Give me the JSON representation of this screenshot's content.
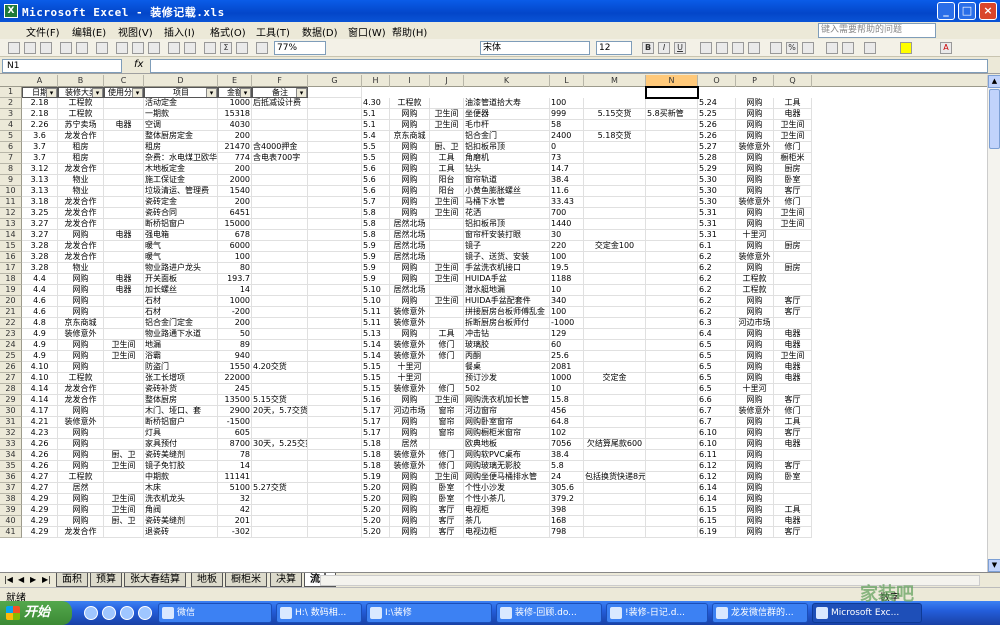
{
  "window": {
    "title": "Microsoft Excel - 装修记载.xls",
    "buttons": [
      "_",
      "□",
      "×"
    ]
  },
  "menu": [
    "文件(F)",
    "编辑(E)",
    "视图(V)",
    "插入(I)",
    "格式(O)",
    "工具(T)",
    "数据(D)",
    "窗口(W)",
    "帮助(H)"
  ],
  "help_placeholder": "键入需要帮助的问题",
  "toolbar": {
    "zoom": "77%",
    "font": "宋体",
    "size": "12",
    "bold": "B",
    "italic": "I",
    "underline": "U"
  },
  "formula_bar": {
    "name_box": "N1",
    "fx": "fx",
    "value": ""
  },
  "col_letters": [
    "A",
    "B",
    "C",
    "D",
    "E",
    "F",
    "G",
    "H",
    "I",
    "J",
    "K",
    "L",
    "M",
    "N",
    "O",
    "P",
    "Q"
  ],
  "headers": [
    "日期",
    "装修大类",
    "使用分类",
    "项目",
    "金额",
    "备注"
  ],
  "left_rows": [
    [
      "2.18",
      "工程款",
      "",
      "活动定金",
      "1000",
      "后抵减设计费"
    ],
    [
      "2.18",
      "工程款",
      "",
      "一期款",
      "15318",
      ""
    ],
    [
      "2.26",
      "苏宁卖场",
      "电器",
      "空调",
      "4030",
      ""
    ],
    [
      "3.6",
      "龙发合作",
      "",
      "整体厨房定金",
      "200",
      ""
    ],
    [
      "3.7",
      "租房",
      "",
      "租房",
      "21470",
      "含4000押金"
    ],
    [
      "3.7",
      "租房",
      "",
      "杂费：水电煤卫欧华",
      "774",
      "含电表700字"
    ],
    [
      "3.12",
      "龙发合作",
      "",
      "木地板定金",
      "200",
      ""
    ],
    [
      "3.13",
      "物业",
      "",
      "施工保证金",
      "2000",
      ""
    ],
    [
      "3.13",
      "物业",
      "",
      "垃圾清运、管理费",
      "1540",
      ""
    ],
    [
      "3.18",
      "龙发合作",
      "",
      "瓷砖定金",
      "200",
      ""
    ],
    [
      "3.25",
      "龙发合作",
      "",
      "瓷砖合同",
      "6451",
      ""
    ],
    [
      "3.27",
      "龙发合作",
      "",
      "断桥铝窗户",
      "15000",
      ""
    ],
    [
      "3.27",
      "网购",
      "电器",
      "强电箱",
      "678",
      ""
    ],
    [
      "3.28",
      "龙发合作",
      "",
      "暖气",
      "6000",
      ""
    ],
    [
      "3.28",
      "龙发合作",
      "",
      "暖气",
      "100",
      ""
    ],
    [
      "3.28",
      "物业",
      "",
      "物业路进户龙头",
      "80",
      ""
    ],
    [
      "4.4",
      "网购",
      "电器",
      "开关面板",
      "193.7",
      ""
    ],
    [
      "4.4",
      "网购",
      "电器",
      "加长螺丝",
      "14",
      ""
    ],
    [
      "4.6",
      "网购",
      "",
      "石材",
      "1000",
      ""
    ],
    [
      "4.6",
      "网购",
      "",
      "石材",
      "-200",
      ""
    ],
    [
      "4.8",
      "京东商城",
      "",
      "铝合金门定金",
      "200",
      ""
    ],
    [
      "4.9",
      "装修意外",
      "",
      "物业路通下水道",
      "50",
      ""
    ],
    [
      "4.9",
      "网购",
      "卫生间",
      "地漏",
      "89",
      ""
    ],
    [
      "4.9",
      "网购",
      "卫生间",
      "浴霸",
      "940",
      ""
    ],
    [
      "4.10",
      "网购",
      "",
      "防盗门",
      "1550",
      "4.20交货"
    ],
    [
      "4.10",
      "工程款",
      "",
      "张工长增项",
      "22000",
      ""
    ],
    [
      "4.14",
      "龙发合作",
      "",
      "瓷砖补货",
      "245",
      ""
    ],
    [
      "4.14",
      "龙发合作",
      "",
      "整体厨房",
      "13500",
      "5.15交货"
    ],
    [
      "4.17",
      "网购",
      "",
      "木门、垭口、套",
      "2900",
      "20天，5.7交货"
    ],
    [
      "4.21",
      "装修意外",
      "",
      "断桥铝窗户",
      "-1500",
      ""
    ],
    [
      "4.23",
      "网购",
      "",
      "灯具",
      "605",
      ""
    ],
    [
      "4.26",
      "网购",
      "",
      "家具预付",
      "8700",
      "30天，5.25交货"
    ],
    [
      "4.26",
      "网购",
      "厨、卫",
      "瓷砖美缝剂",
      "78",
      ""
    ],
    [
      "4.26",
      "网购",
      "卫生间",
      "镜子免钉胶",
      "14",
      ""
    ],
    [
      "4.27",
      "工程款",
      "",
      "中期款",
      "11141",
      ""
    ],
    [
      "4.27",
      "居然",
      "",
      "木床",
      "5100",
      "5.27交货"
    ],
    [
      "4.29",
      "网购",
      "卫生间",
      "洗衣机龙头",
      "32",
      ""
    ],
    [
      "4.29",
      "网购",
      "卫生间",
      "角阀",
      "42",
      ""
    ],
    [
      "4.29",
      "网购",
      "厨、卫",
      "瓷砖美缝剂",
      "201",
      ""
    ],
    [
      "4.29",
      "龙发合作",
      "",
      "退瓷砖",
      "-302",
      ""
    ]
  ],
  "mid_rows": [
    [
      "4.30",
      "工程款",
      "",
      "油漆管道拾大寿",
      "100",
      "",
      ""
    ],
    [
      "5.1",
      "网购",
      "卫生间",
      "坐便器",
      "999",
      "5.15交货",
      "5.8买新管"
    ],
    [
      "5.1",
      "网购",
      "卫生间",
      "毛巾杆",
      "58",
      "",
      ""
    ],
    [
      "5.4",
      "京东商城",
      "",
      "铝合金门",
      "2400",
      "5.18交货",
      ""
    ],
    [
      "5.5",
      "网购",
      "厨、卫",
      "铝扣板吊顶",
      "0",
      "",
      ""
    ],
    [
      "5.5",
      "网购",
      "工具",
      "角磨机",
      "73",
      "",
      ""
    ],
    [
      "5.6",
      "网购",
      "工具",
      "钻头",
      "14.7",
      "",
      ""
    ],
    [
      "5.6",
      "网购",
      "阳台",
      "窗帘轨道",
      "38.4",
      "",
      ""
    ],
    [
      "5.6",
      "网购",
      "阳台",
      "小黄鱼膨胀螺丝",
      "11.6",
      "",
      ""
    ],
    [
      "5.7",
      "网购",
      "卫生间",
      "马桶下水管",
      "33.43",
      "",
      ""
    ],
    [
      "5.8",
      "网购",
      "卫生间",
      "花洒",
      "700",
      "",
      ""
    ],
    [
      "5.8",
      "居然北场",
      "",
      "铝扣板吊顶",
      "1440",
      "",
      ""
    ],
    [
      "5.8",
      "居然北场",
      "",
      "窗帘杆安装打眼",
      "30",
      "",
      ""
    ],
    [
      "5.9",
      "居然北场",
      "",
      "镜子",
      "220",
      "交定金100",
      ""
    ],
    [
      "5.9",
      "居然北场",
      "",
      "镜子、送货、安装",
      "100",
      "",
      ""
    ],
    [
      "5.9",
      "网购",
      "卫生间",
      "手盆洗衣机接口",
      "19.5",
      "",
      ""
    ],
    [
      "5.9",
      "网购",
      "卫生间",
      "HUIDA手盆",
      "1188",
      "",
      ""
    ],
    [
      "5.10",
      "居然北场",
      "",
      "潜水艇地漏",
      "10",
      "",
      ""
    ],
    [
      "5.10",
      "网购",
      "卫生间",
      "HUIDA手盆配套件",
      "340",
      "",
      ""
    ],
    [
      "5.11",
      "装修意外",
      "",
      "拼接厨房台板师傅乱金",
      "100",
      "",
      ""
    ],
    [
      "5.11",
      "装修意外",
      "",
      "拆断厨房台板师付",
      "-1000",
      "",
      ""
    ],
    [
      "5.13",
      "网购",
      "工具",
      "冲击钻",
      "129",
      "",
      ""
    ],
    [
      "5.14",
      "装修意外",
      "修门",
      "玻璃胶",
      "60",
      "",
      ""
    ],
    [
      "5.14",
      "装修意外",
      "修门",
      "丙酮",
      "25.6",
      "",
      ""
    ],
    [
      "5.15",
      "十里河",
      "",
      "餐桌",
      "2081",
      "",
      ""
    ],
    [
      "5.15",
      "十里河",
      "",
      "预订沙发",
      "1000",
      "交定金",
      ""
    ],
    [
      "5.15",
      "装修意外",
      "修门",
      "502",
      "10",
      "",
      ""
    ],
    [
      "5.16",
      "网购",
      "卫生间",
      "网购洗衣机加长管",
      "15.8",
      "",
      ""
    ],
    [
      "5.17",
      "河边市场",
      "窗帘",
      "河边窗帘",
      "456",
      "",
      ""
    ],
    [
      "5.17",
      "网购",
      "窗帘",
      "网购卧室窗帘",
      "64.8",
      "",
      ""
    ],
    [
      "5.17",
      "网购",
      "窗帘",
      "网购橱柜米窗帘",
      "102",
      "",
      ""
    ],
    [
      "5.18",
      "居然",
      "",
      "欧典地板",
      "7056",
      "欠结算尾款600",
      ""
    ],
    [
      "5.18",
      "装修意外",
      "修门",
      "网购软PVC桌布",
      "38.4",
      "",
      ""
    ],
    [
      "5.18",
      "装修意外",
      "修门",
      "网购玻璃无影胶",
      "5.8",
      "",
      ""
    ],
    [
      "5.19",
      "网购",
      "卫生间",
      "网购坐便马桶排水管",
      "24",
      "包括换货快递8元",
      ""
    ],
    [
      "5.20",
      "网购",
      "卧室",
      "个性小沙发",
      "305.6",
      "",
      ""
    ],
    [
      "5.20",
      "网购",
      "卧室",
      "个性小茶几",
      "379.2",
      "",
      ""
    ],
    [
      "5.20",
      "网购",
      "客厅",
      "电视柜",
      "398",
      "",
      ""
    ],
    [
      "5.20",
      "网购",
      "客厅",
      "茶几",
      "168",
      "",
      ""
    ],
    [
      "5.20",
      "网购",
      "客厅",
      "电视边柜",
      "798",
      "",
      ""
    ]
  ],
  "right_rows": [
    [
      "5.24",
      "网购",
      "工具"
    ],
    [
      "5.25",
      "网购",
      "电器"
    ],
    [
      "5.26",
      "网购",
      "卫生间"
    ],
    [
      "5.26",
      "网购",
      "卫生间"
    ],
    [
      "5.27",
      "装修意外",
      "修门"
    ],
    [
      "5.28",
      "网购",
      "橱柜米"
    ],
    [
      "5.29",
      "网购",
      "厨房"
    ],
    [
      "5.30",
      "网购",
      "卧室"
    ],
    [
      "5.30",
      "网购",
      "客厅"
    ],
    [
      "5.30",
      "装修意外",
      "修门"
    ],
    [
      "5.31",
      "网购",
      "卫生间"
    ],
    [
      "5.31",
      "网购",
      "卫生间"
    ],
    [
      "5.31",
      "十里河",
      ""
    ],
    [
      "6.1",
      "网购",
      "厨房"
    ],
    [
      "6.2",
      "装修意外",
      ""
    ],
    [
      "6.2",
      "网购",
      "厨房"
    ],
    [
      "6.2",
      "工程款",
      ""
    ],
    [
      "6.2",
      "工程款",
      ""
    ],
    [
      "6.2",
      "网购",
      "客厅"
    ],
    [
      "6.2",
      "网购",
      "客厅"
    ],
    [
      "6.3",
      "河边市场",
      ""
    ],
    [
      "6.4",
      "网购",
      "电器"
    ],
    [
      "6.5",
      "网购",
      "电器"
    ],
    [
      "6.5",
      "网购",
      "卫生间"
    ],
    [
      "6.5",
      "网购",
      "电器"
    ],
    [
      "6.5",
      "网购",
      "电器"
    ],
    [
      "6.5",
      "十里河",
      ""
    ],
    [
      "6.6",
      "网购",
      "客厅"
    ],
    [
      "6.7",
      "装修意外",
      "修门"
    ],
    [
      "6.7",
      "网购",
      "工具"
    ],
    [
      "6.10",
      "网购",
      "客厅"
    ],
    [
      "6.10",
      "网购",
      "电器"
    ],
    [
      "6.11",
      "网购",
      ""
    ],
    [
      "6.12",
      "网购",
      "客厅"
    ],
    [
      "6.12",
      "网购",
      "卧室"
    ],
    [
      "6.14",
      "网购",
      ""
    ],
    [
      "6.14",
      "网购",
      ""
    ],
    [
      "6.15",
      "网购",
      "工具"
    ],
    [
      "6.15",
      "网购",
      "电器"
    ],
    [
      "6.19",
      "网购",
      "客厅"
    ]
  ],
  "row_numbers": [
    "1",
    "2",
    "3",
    "4",
    "5",
    "6",
    "7",
    "8",
    "9",
    "10",
    "11",
    "12",
    "13",
    "14",
    "15",
    "16",
    "17",
    "18",
    "19",
    "20",
    "21",
    "22",
    "23",
    "24",
    "25",
    "26",
    "27",
    "28",
    "29",
    "30",
    "31",
    "32",
    "33",
    "34",
    "35",
    "36",
    "37",
    "38",
    "39",
    "40",
    "41"
  ],
  "sheet_tabs": [
    "面积",
    "预算",
    "张大春结算",
    "地板",
    "橱柜米",
    "决算",
    "流水"
  ],
  "active_tab": "流水",
  "status": {
    "left": "就绪",
    "right": "数字"
  },
  "taskbar": {
    "start": "开始",
    "tasks": [
      "微信",
      "H:\\ 数码相...",
      "I:\\装修",
      "装修-回顾.do...",
      "!装修-日记.d...",
      "龙发微信群的...",
      "Microsoft Exc..."
    ]
  },
  "watermark": "家装吧"
}
